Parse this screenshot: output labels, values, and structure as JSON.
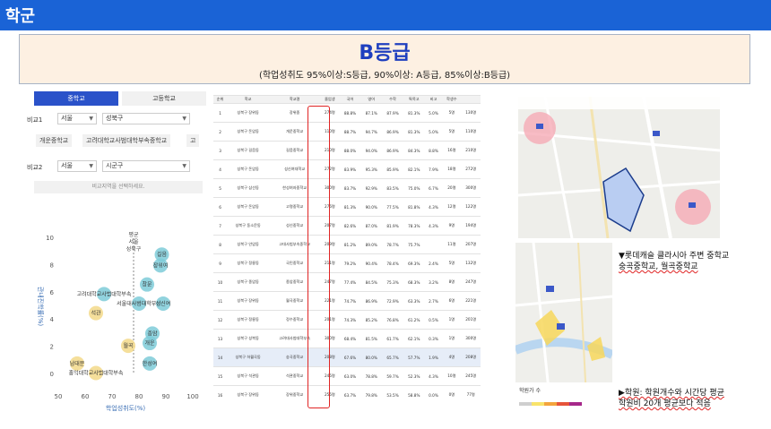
{
  "header": {
    "title": "학군"
  },
  "grade": {
    "title": "B등급",
    "subtitle": "(학업성취도 95%이상:S등급, 90%이상: A등급, 85%이상:B등급)"
  },
  "filter": {
    "tabs": [
      "중학교",
      "고등학교"
    ],
    "row1": {
      "label": "비교1",
      "city": "서울",
      "district": "성북구"
    },
    "chips": [
      "개운중학교",
      "고려대학교사범대학부속중학교",
      "고"
    ],
    "row2": {
      "label": "비교2",
      "city": "서울",
      "district": "시군구"
    },
    "hint": "비교지역을 선택하세요."
  },
  "chart_data": {
    "type": "scatter",
    "xlabel": "학업성취도(%)",
    "ylabel": "관내진학률(%)",
    "xlim": [
      50,
      100
    ],
    "ylim": [
      0,
      10
    ],
    "xticks": [
      50,
      60,
      70,
      80,
      90,
      100
    ],
    "yticks": [
      0,
      2,
      4,
      6,
      8,
      10
    ],
    "points": [
      {
        "label": "길음",
        "x": 88.5,
        "y": 8.8,
        "color": "#7ecbd8"
      },
      {
        "label": "장위여",
        "x": 88.0,
        "y": 8.0,
        "color": "#7ecbd8"
      },
      {
        "label": "창문",
        "x": 83.0,
        "y": 6.6,
        "color": "#7ecbd8"
      },
      {
        "label": "고려대학교사범대학부속",
        "x": 67.0,
        "y": 5.9,
        "color": "#7ecbd8"
      },
      {
        "label": "서울대사범대학부설",
        "x": 80.0,
        "y": 5.2,
        "color": "#7ecbd8"
      },
      {
        "label": "성신여",
        "x": 89.0,
        "y": 5.2,
        "color": "#7ecbd8"
      },
      {
        "label": "석관",
        "x": 64.0,
        "y": 4.5,
        "color": "#f3d98a"
      },
      {
        "label": "종암",
        "x": 85.0,
        "y": 3.0,
        "color": "#7ecbd8"
      },
      {
        "label": "월곡",
        "x": 76.0,
        "y": 2.1,
        "color": "#f3d98a"
      },
      {
        "label": "개운",
        "x": 84.0,
        "y": 2.3,
        "color": "#7ecbd8"
      },
      {
        "label": "한성여",
        "x": 84.0,
        "y": 0.8,
        "color": "#7ecbd8"
      },
      {
        "label": "남대문",
        "x": 57.0,
        "y": 0.8,
        "color": "#f3d98a"
      },
      {
        "label": "홍익대학교사범대학부속",
        "x": 64.0,
        "y": 0.1,
        "color": "#f3d98a"
      }
    ],
    "top_labels": [
      "평균",
      "서울",
      "성북구"
    ]
  },
  "table": {
    "headers": [
      "순위",
      "학교",
      "학교명",
      "졸업생",
      "국어",
      "영어",
      "수학",
      "특목고",
      "비고",
      "학생수"
    ],
    "rows": [
      [
        "1",
        "성북구 장위동",
        "장위중",
        "274명",
        "88.8%",
        "87.1%",
        "87.9%",
        "81.3%",
        "5.0%",
        "5명",
        "130명"
      ],
      [
        "2",
        "성북구 돈암동",
        "개운중학교",
        "110명",
        "88.7%",
        "94.7%",
        "86.9%",
        "81.3%",
        "5.0%",
        "5명",
        "110명"
      ],
      [
        "3",
        "성북구 길음동",
        "길음중학교",
        "210명",
        "88.0%",
        "94.0%",
        "86.9%",
        "84.3%",
        "8.8%",
        "16명",
        "210명"
      ],
      [
        "4",
        "성북구 돈암동",
        "성신여대학교",
        "272명",
        "83.9%",
        "95.3%",
        "85.9%",
        "82.1%",
        "7.9%",
        "18명",
        "272명"
      ],
      [
        "5",
        "성북구 삼선동",
        "한성여자중학교",
        "300명",
        "83.7%",
        "92.9%",
        "83.5%",
        "75.0%",
        "6.7%",
        "20명",
        "300명"
      ],
      [
        "6",
        "성북구 돈암동",
        "고명중학교",
        "276명",
        "81.3%",
        "90.0%",
        "77.5%",
        "81.8%",
        "4.3%",
        "12명",
        "122명"
      ],
      [
        "7",
        "성북구 동소문동",
        "성신중학교",
        "207명",
        "82.6%",
        "87.0%",
        "81.9%",
        "78.3%",
        "4.3%",
        "9명",
        "194명"
      ],
      [
        "8",
        "성북구 안암동",
        "고대사범부속중학교",
        "209명",
        "81.2%",
        "89.0%",
        "78.7%",
        "75.7%",
        "",
        "11명",
        "207명"
      ],
      [
        "9",
        "성북구 정릉동",
        "국민중학교",
        "211명",
        "79.2%",
        "90.4%",
        "78.4%",
        "69.3%",
        "2.4%",
        "5명",
        "132명"
      ],
      [
        "10",
        "성북구 종암동",
        "종암중학교",
        "247명",
        "77.4%",
        "84.5%",
        "75.3%",
        "68.3%",
        "3.2%",
        "8명",
        "247명"
      ],
      [
        "11",
        "성북구 장위동",
        "월곡중학교",
        "221명",
        "74.7%",
        "86.9%",
        "72.9%",
        "63.3%",
        "2.7%",
        "6명",
        "221명"
      ],
      [
        "12",
        "성북구 정릉동",
        "정수중학교",
        "201명",
        "74.3%",
        "85.2%",
        "76.8%",
        "61.2%",
        "0.5%",
        "1명",
        "201명"
      ],
      [
        "13",
        "성북구 성북동",
        "고려대사범대학부속",
        "300명",
        "68.4%",
        "81.5%",
        "61.7%",
        "62.1%",
        "0.3%",
        "1명",
        "300명"
      ],
      [
        "14",
        "성북구 하월곡동",
        "숭곡중학교",
        "208명",
        "67.6%",
        "80.0%",
        "65.7%",
        "57.7%",
        "1.9%",
        "4명",
        "208명"
      ],
      [
        "15",
        "성북구 석관동",
        "석관중학교",
        "245명",
        "63.0%",
        "78.8%",
        "59.7%",
        "52.3%",
        "4.3%",
        "10명",
        "245명"
      ],
      [
        "16",
        "성북구 장위동",
        "장위중학교",
        "255명",
        "63.7%",
        "79.8%",
        "53.5%",
        "58.8%",
        "0.0%",
        "0명",
        "77명"
      ]
    ]
  },
  "notes": {
    "note1_line1": "▼롯데캐슬 클라시아 주변 중학교",
    "note1_line2": "숭곡중학교, 월곡중학교",
    "note2_line1": "▶학원: 학원개수와 시간당 평균",
    "note2_line2": "학원비 20개 평균보다 적음"
  },
  "map2": {
    "legend_title": "학원가 수"
  }
}
